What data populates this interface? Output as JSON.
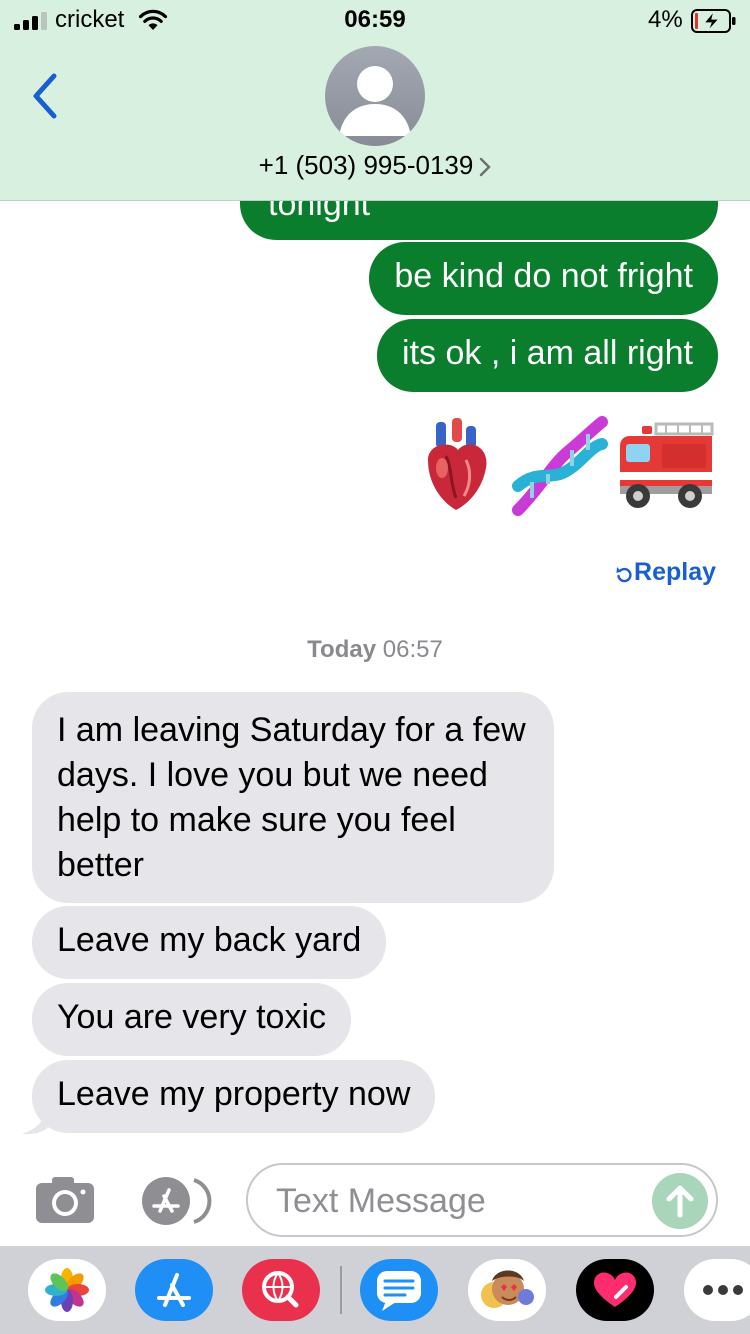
{
  "status_bar": {
    "carrier": "cricket",
    "time": "06:59",
    "battery_percent": "4%"
  },
  "header": {
    "contact": "+1 (503) 995-0139"
  },
  "messages": {
    "sent": [
      "tonight",
      "be kind do not fright",
      "its ok , i am all right"
    ],
    "emoji": [
      "anatomical-heart",
      "dna",
      "fire-engine"
    ],
    "replay_label": "Replay",
    "timestamp_day": "Today",
    "timestamp_time": "06:57",
    "received": [
      "I am leaving Saturday for a few days. I love you but we need help to make sure you feel better",
      "Leave my back yard",
      "You are very toxic",
      "Leave my property now"
    ]
  },
  "composer": {
    "placeholder": "Text Message"
  },
  "app_drawer": {
    "apps": [
      "photos",
      "app-store",
      "web-search",
      "messages-extension",
      "memoji",
      "digital-touch",
      "more"
    ]
  },
  "colors": {
    "header_bg": "#d8f0df",
    "sent_bubble": "#0a7e2c",
    "received_bubble": "#e5e5ea",
    "link": "#1a5fd0",
    "send_button": "#a9d5bb"
  }
}
